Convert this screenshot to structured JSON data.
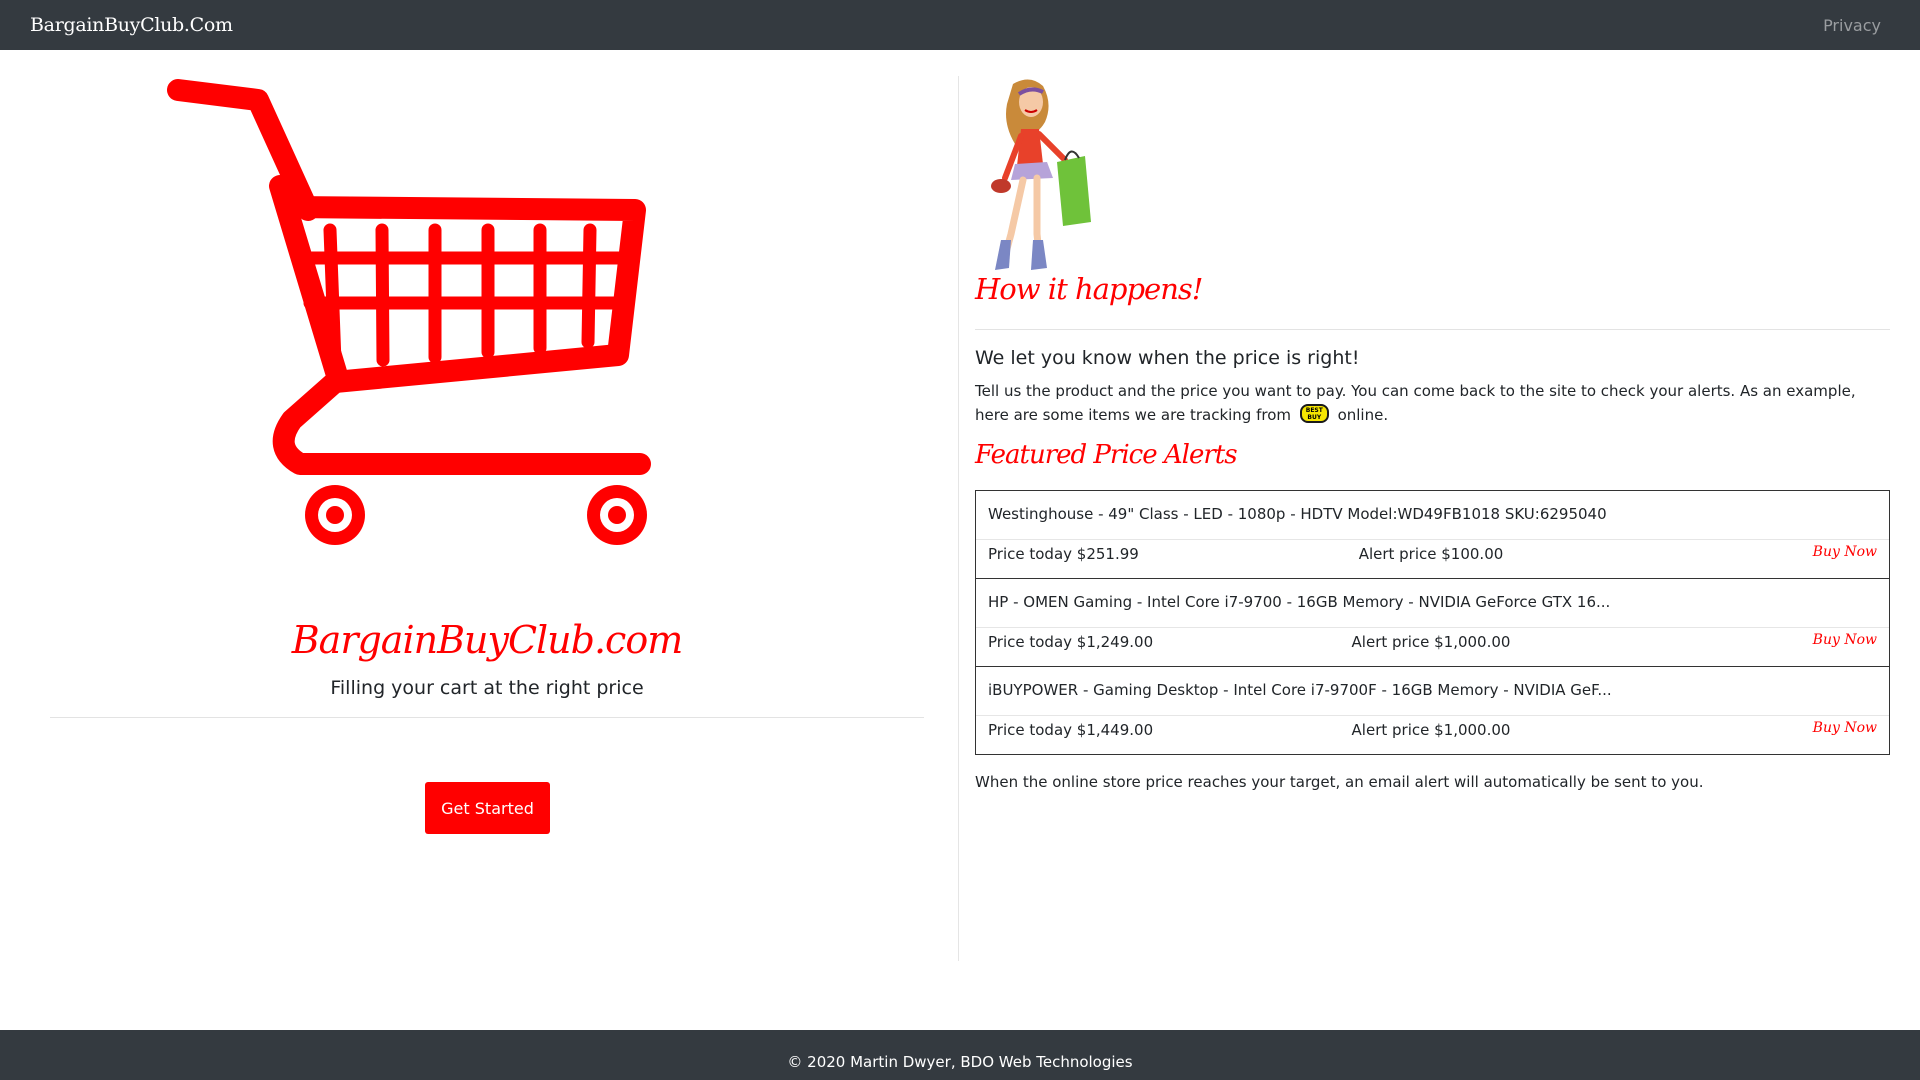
{
  "navbar": {
    "brand": "BargainBuyClub.Com",
    "privacy_link": "Privacy"
  },
  "hero": {
    "logo_text": "BargainBuyClub.com",
    "tagline": "Filling your cart at the right price",
    "get_started_label": "Get Started"
  },
  "info": {
    "how_title": "How it happens!",
    "lead": "We let you know when the price is right!",
    "desc_part1": "Tell us the product and the price you want to pay. You can come back to the site to check your alerts. As an example, here are some items we are tracking from",
    "store_logo_text": "BEST BUY",
    "desc_part2": "online.",
    "featured_title": "Featured Price Alerts",
    "note": "When the online store price reaches your target, an email alert will automatically be sent to you."
  },
  "alerts": [
    {
      "title": "Westinghouse - 49\" Class - LED - 1080p - HDTV Model:WD49FB1018 SKU:6295040",
      "price_today": "Price today $251.99",
      "alert_price": "Alert price $100.00",
      "buy_label": "Buy Now"
    },
    {
      "title": "HP - OMEN Gaming - Intel Core i7-9700 - 16GB Memory - NVIDIA GeForce GTX 16...",
      "price_today": "Price today $1,249.00",
      "alert_price": "Alert price $1,000.00",
      "buy_label": "Buy Now"
    },
    {
      "title": "iBUYPOWER - Gaming Desktop - Intel Core i7-9700F - 16GB Memory - NVIDIA GeF...",
      "price_today": "Price today $1,449.00",
      "alert_price": "Alert price $1,000.00",
      "buy_label": "Buy Now"
    }
  ],
  "footer": {
    "text": "© 2020 Martin Dwyer, BDO Web Technologies"
  },
  "icons": {
    "cart": "shopping-cart-icon",
    "shopper": "shopper-illustration",
    "store": "best-buy-logo"
  },
  "colors": {
    "accent": "#ff0000",
    "navbar": "#343a40",
    "footer": "#343a40",
    "store_logo": "#f6e600"
  }
}
